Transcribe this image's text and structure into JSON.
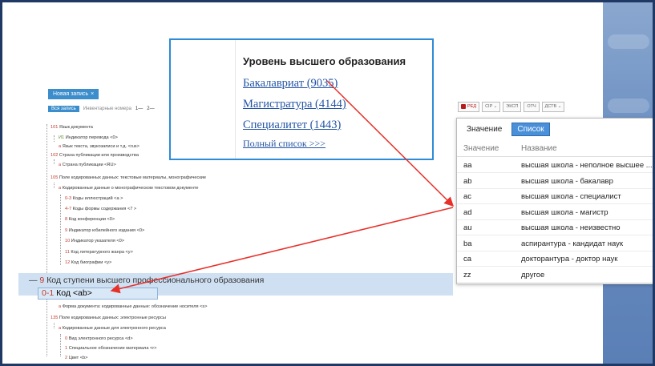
{
  "tabs": {
    "new_record": "Новая запись",
    "close": "×"
  },
  "subtabs": {
    "all": "Вся запись",
    "inventory": "Инвентарные номера",
    "p1": "1—",
    "p2": "2—"
  },
  "tree": {
    "n101": {
      "code": "101",
      "label": "Язык документа"
    },
    "nI1": {
      "code": "И1",
      "label": "Индикатор перевода <0>"
    },
    "n101a": {
      "code": "а",
      "label": "Язык текста, звукозаписи и т.д. <rus>"
    },
    "n102": {
      "code": "102",
      "label": "Страна публикации или производства"
    },
    "n102a": {
      "code": "а",
      "label": "Страна публикации <RU>"
    },
    "n105": {
      "code": "105",
      "label": "Поле кодированных данных: текстовые материалы, монографические"
    },
    "n105a": {
      "code": "а",
      "label": "Кодированные данные о монографическом текстовом документе"
    },
    "n03": {
      "code": "0-3",
      "label": "Коды иллюстраций <а >"
    },
    "n47": {
      "code": "4-7",
      "label": "Коды формы содержания <7 >"
    },
    "n8": {
      "code": "8",
      "label": "Код конференции <0>"
    },
    "n9": {
      "code": "9",
      "label": "Индикатор юбилейного издания <0>"
    },
    "n10": {
      "code": "10",
      "label": "Индикатор указателя <0>"
    },
    "n11": {
      "code": "11",
      "label": "Код литературного жанра <y>"
    },
    "n12": {
      "code": "12",
      "label": "Код биографии <y>"
    },
    "n9big": {
      "code": "9",
      "label": "Код ступени высшего профессионального образования"
    },
    "n01big": {
      "code": "0-1",
      "label": "Код <ab>"
    },
    "nForm": {
      "code": "а",
      "label": "Форма документа: кодированные данные: обозначение носителя <s>"
    },
    "n135": {
      "code": "135",
      "label": "Поле кодированных данных: электронные ресурсы"
    },
    "n135a": {
      "code": "а",
      "label": "Кодированные данные для электронного ресурса"
    },
    "n0": {
      "code": "0",
      "label": "Вид электронного ресурса <d>"
    },
    "n1": {
      "code": "1",
      "label": "Специальное обозначение материала <r>"
    },
    "n2": {
      "code": "2",
      "label": "Цвет <b>"
    }
  },
  "edu_popup": {
    "title": "Уровень высшего образования",
    "links": [
      "Бакалавриат (9035)",
      "Магистратура (4144)",
      "Специалитет (1443)"
    ],
    "full_list": "Полный список >>>"
  },
  "toolbar": {
    "edit": "РЕД",
    "cip": "CIP ⌄",
    "exp": "ЭКСП",
    "rep": "ОТЧ",
    "act": "ДСТВ ⌄"
  },
  "list_popup": {
    "tab_value": "Значение",
    "tab_list": "Список",
    "col_value": "Значение",
    "col_name": "Название",
    "rows": [
      {
        "v": "aa",
        "n": "высшая школа - неполное высшее ..."
      },
      {
        "v": "ab",
        "n": "высшая школа - бакалавр"
      },
      {
        "v": "ac",
        "n": "высшая школа - специалист"
      },
      {
        "v": "ad",
        "n": "высшая школа - магистр"
      },
      {
        "v": "au",
        "n": "высшая школа - неизвестно"
      },
      {
        "v": "ba",
        "n": "аспирантура - кандидат наук"
      },
      {
        "v": "ca",
        "n": "докторантура - доктор наук"
      },
      {
        "v": "zz",
        "n": "другое"
      }
    ]
  },
  "colors": {
    "accent": "#3c8dcc",
    "arrow": "#e8302a",
    "code": "#c0392b",
    "highlight": "#cfe0f3"
  }
}
